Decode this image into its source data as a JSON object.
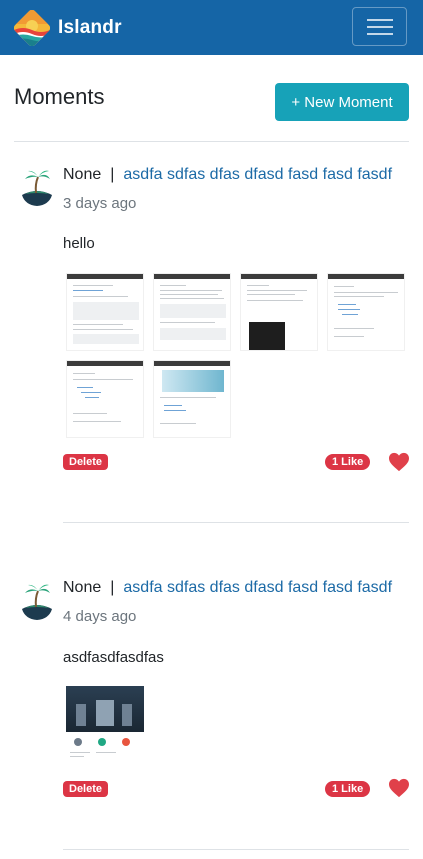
{
  "navbar": {
    "brand": "Islandr",
    "logo_icon": "island-sunset-logo-icon",
    "menu_icon": "hamburger-menu-icon",
    "color": "#1565a6"
  },
  "header": {
    "title": "Moments",
    "new_button": "+ New Moment"
  },
  "separator": "|",
  "posts": [
    {
      "author": "None",
      "group": "asdfa sdfas dfas dfasd fasd fasd fasdf",
      "time": "3 days ago",
      "text": "hello",
      "delete_label": "Delete",
      "likes": "1 Like",
      "image_count": 6
    },
    {
      "author": "None",
      "group": "asdfa sdfas dfas dfasd fasd fasd fasdf",
      "time": "4 days ago",
      "text": "asdfasdfasdfas",
      "delete_label": "Delete",
      "likes": "1 Like",
      "image_count": 1
    }
  ],
  "colors": {
    "accent": "#17a2b8",
    "danger": "#dc3545",
    "link": "#1c6aa6",
    "muted": "#6c757d"
  }
}
